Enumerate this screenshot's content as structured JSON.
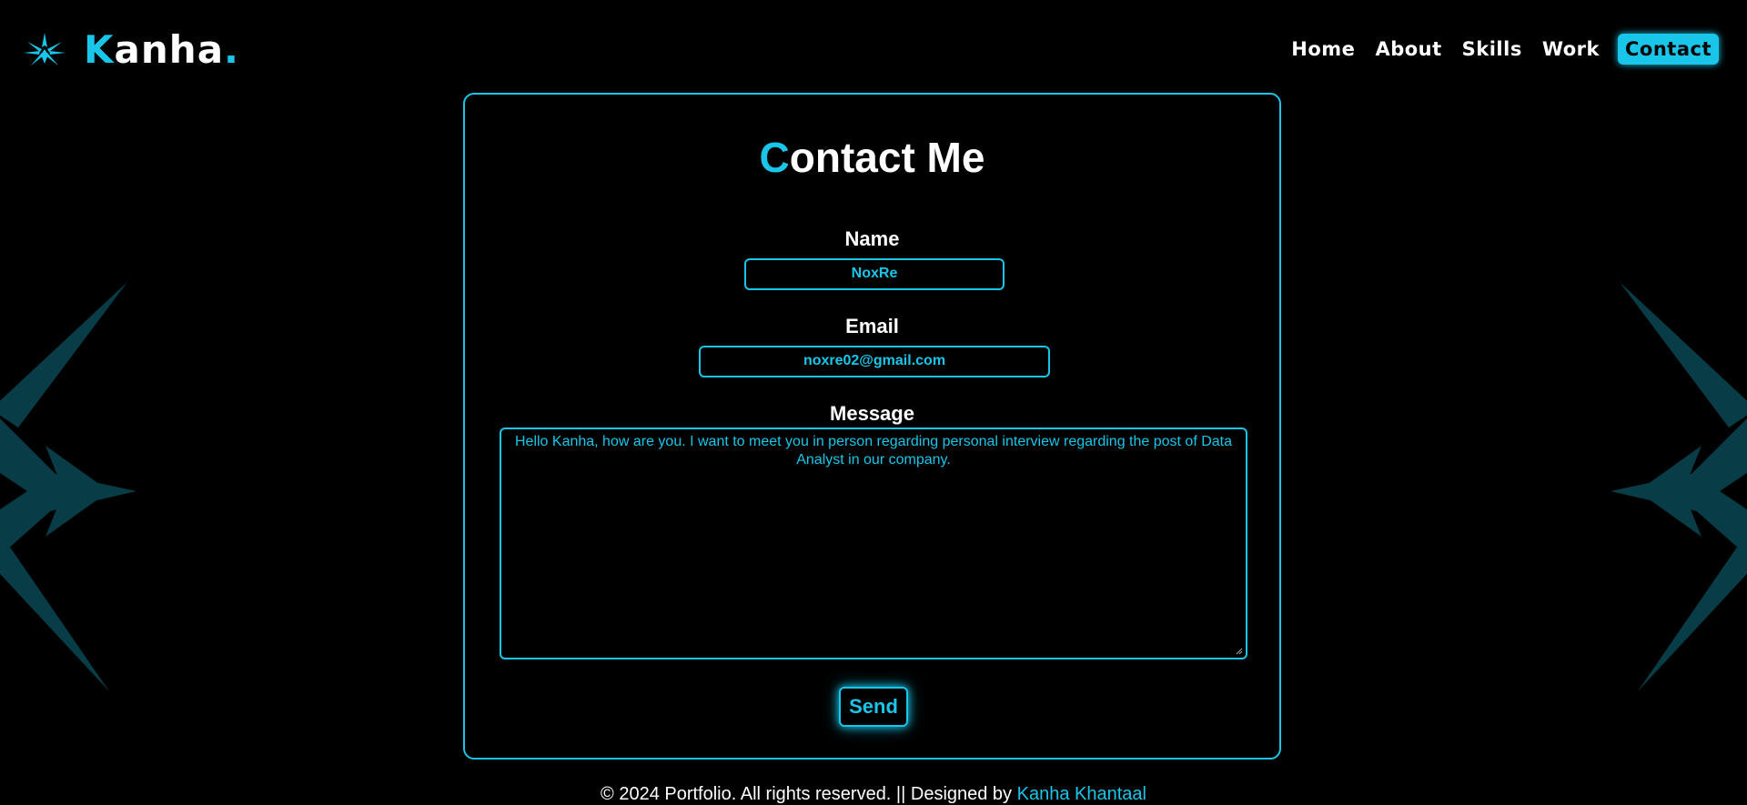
{
  "colors": {
    "accent": "#19c6ea",
    "background": "#000000",
    "text": "#ffffff",
    "emblem": "#0f6f82"
  },
  "header": {
    "logo_icon": "spiky-emblem-icon",
    "logo_initial": "K",
    "logo_rest": "anha",
    "logo_dot": ".",
    "nav": [
      {
        "label": "Home"
      },
      {
        "label": "About"
      },
      {
        "label": "Skills"
      },
      {
        "label": "Work"
      },
      {
        "label": "Contact",
        "active": true
      }
    ]
  },
  "contact": {
    "title_initial": "C",
    "title_rest": "ontact Me",
    "name_label": "Name",
    "name_value": "NoxRe",
    "email_label": "Email",
    "email_value": "noxre02@gmail.com",
    "message_label": "Message",
    "message_value": "Hello Kanha, how are you. I want to meet you in person regarding personal interview regarding the post of Data Analyst in our company.",
    "send_label": "Send"
  },
  "footer": {
    "text": "© 2024 Portfolio. All rights reserved. || Designed by ",
    "author": "Kanha Khantaal"
  }
}
